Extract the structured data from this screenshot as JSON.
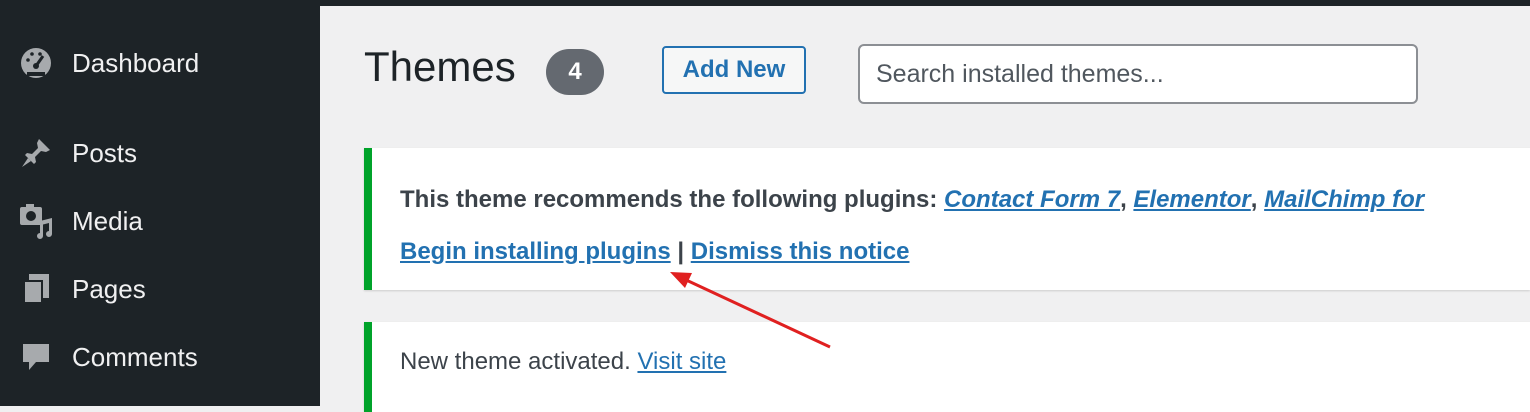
{
  "sidebar": {
    "items": [
      {
        "label": "Dashboard",
        "icon": "dashboard-icon"
      },
      {
        "label": "Posts",
        "icon": "pushpin-icon"
      },
      {
        "label": "Media",
        "icon": "media-icon"
      },
      {
        "label": "Pages",
        "icon": "pages-icon"
      },
      {
        "label": "Comments",
        "icon": "comment-icon"
      }
    ]
  },
  "header": {
    "title": "Themes",
    "count": "4",
    "add_new_label": "Add New",
    "search_placeholder": "Search installed themes..."
  },
  "notice_plugins": {
    "text": "This theme recommends the following plugins: ",
    "plugins": [
      "Contact Form 7",
      "Elementor",
      "MailChimp for"
    ],
    "separator": ", ",
    "begin_link": "Begin installing plugins",
    "divider": " | ",
    "dismiss_link": "Dismiss this notice"
  },
  "notice_activated": {
    "text": "New theme activated. ",
    "visit_link": "Visit site"
  },
  "colors": {
    "sidebar_bg": "#1d2327",
    "accent": "#2271b1",
    "success": "#00a32a",
    "annotation_arrow": "#e02020"
  }
}
